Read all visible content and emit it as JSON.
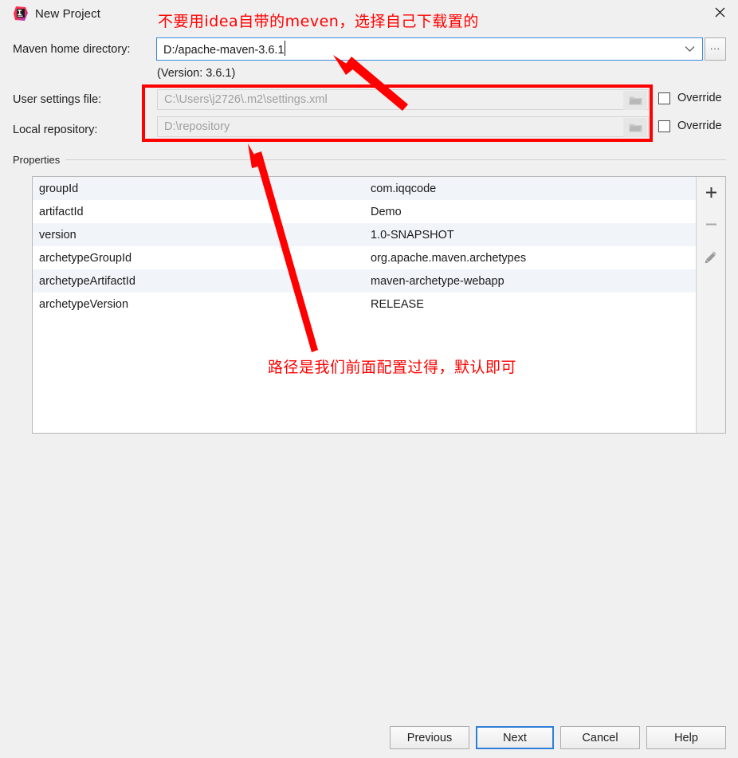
{
  "window": {
    "title": "New Project",
    "icon": "intellij-idea-icon",
    "close_icon": "close-icon"
  },
  "form": {
    "maven_home": {
      "label": "Maven home directory:",
      "value": "D:/apache-maven-3.6.1",
      "dropdown_icon": "chevron-down-icon",
      "browse_label": "...",
      "version_note": "(Version: 3.6.1)"
    },
    "user_settings": {
      "label": "User settings file:",
      "value": "C:\\Users\\j2726\\.m2\\settings.xml",
      "folder_icon": "folder-icon",
      "override_label": "Override",
      "override_checked": false
    },
    "local_repository": {
      "label": "Local repository:",
      "value": "D:\\repository",
      "folder_icon": "folder-icon",
      "override_label": "Override",
      "override_checked": false
    }
  },
  "properties": {
    "group_title": "Properties",
    "rows": [
      {
        "key": "groupId",
        "value": "com.iqqcode"
      },
      {
        "key": "artifactId",
        "value": "Demo"
      },
      {
        "key": "version",
        "value": "1.0-SNAPSHOT"
      },
      {
        "key": "archetypeGroupId",
        "value": "org.apache.maven.archetypes"
      },
      {
        "key": "archetypeArtifactId",
        "value": "maven-archetype-webapp"
      },
      {
        "key": "archetypeVersion",
        "value": "RELEASE"
      }
    ],
    "toolbar": {
      "add_icon": "plus-icon",
      "remove_icon": "minus-icon",
      "edit_icon": "pencil-icon"
    }
  },
  "footer": {
    "previous_label": "Previous",
    "next_label": "Next",
    "cancel_label": "Cancel",
    "help_label": "Help"
  },
  "annotations": {
    "color": "#ff0000",
    "top_note": "不要用idea自带的meven，选择自己下载置的",
    "middle_note": "路径是我们前面配置过得，默认即可"
  }
}
